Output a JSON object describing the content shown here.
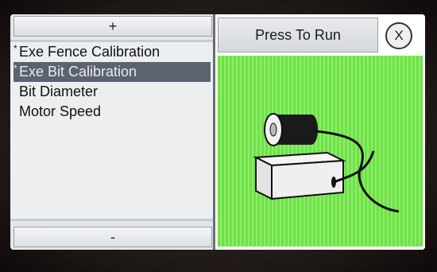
{
  "scroll_up": {
    "label": "+"
  },
  "scroll_down": {
    "label": "-"
  },
  "menu": {
    "items": [
      {
        "label": "Exe Fence Calibration",
        "marker": "*",
        "selected": false
      },
      {
        "label": "Exe Bit Calibration",
        "marker": "*",
        "selected": true
      },
      {
        "label": "Bit Diameter",
        "marker": "",
        "selected": false
      },
      {
        "label": "Motor Speed",
        "marker": "",
        "selected": false
      }
    ]
  },
  "run_button": {
    "label": "Press To Run"
  },
  "close_button": {
    "label": "X"
  },
  "illustration": {
    "icon": "router-bit-calibration-icon",
    "background_color": "#7ee85a"
  },
  "colors": {
    "selected_row": "#5b6270",
    "accent_green": "#7ee85a"
  }
}
